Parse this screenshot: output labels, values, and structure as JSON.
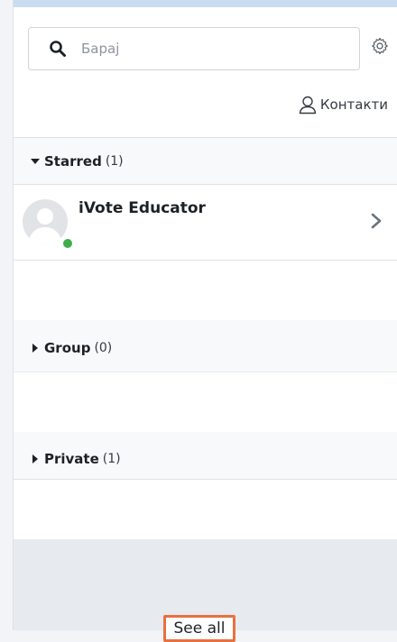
{
  "search": {
    "placeholder": "Барај",
    "value": ""
  },
  "contacts_link": {
    "label": "Контакти"
  },
  "sections": {
    "starred": {
      "title": "Starred",
      "count": "(1)",
      "expanded": true
    },
    "group": {
      "title": "Group",
      "count": "(0)",
      "expanded": false
    },
    "private": {
      "title": "Private",
      "count": "(1)",
      "expanded": false
    }
  },
  "starred_contacts": [
    {
      "name": "iVote Educator",
      "online": true
    }
  ],
  "footer": {
    "see_all_label": "See all"
  },
  "colors": {
    "online_status": "#3fae4a",
    "focus_outline": "#e8713f",
    "top_accent": "#c9dcf0"
  },
  "icons": [
    "search-icon",
    "gear-icon",
    "user-icon",
    "caret-down-icon",
    "caret-right-icon",
    "chevron-right-icon"
  ]
}
